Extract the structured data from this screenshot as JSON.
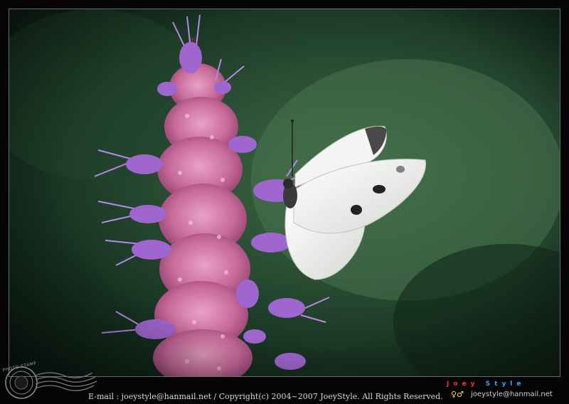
{
  "caption": "E-mail : joeystyle@hanmail.net / Copyright(c) 2004~2007 JoeyStyle. All Rights Reserved.",
  "stamp": {
    "label": "PHOTO STAMP"
  },
  "brand": {
    "title_part1": "Joey",
    "title_part2": "Style",
    "email": "joeystyle@hanmail.net",
    "figures": "♀♂"
  },
  "colors": {
    "background": "#050505",
    "foliage": "#2b4f34",
    "flower_pink": "#c86a9a",
    "flower_violet": "#a066d0",
    "butterfly_wing": "#ececec",
    "brand_red": "#ff2a2a",
    "brand_blue": "#3aa0ff"
  }
}
